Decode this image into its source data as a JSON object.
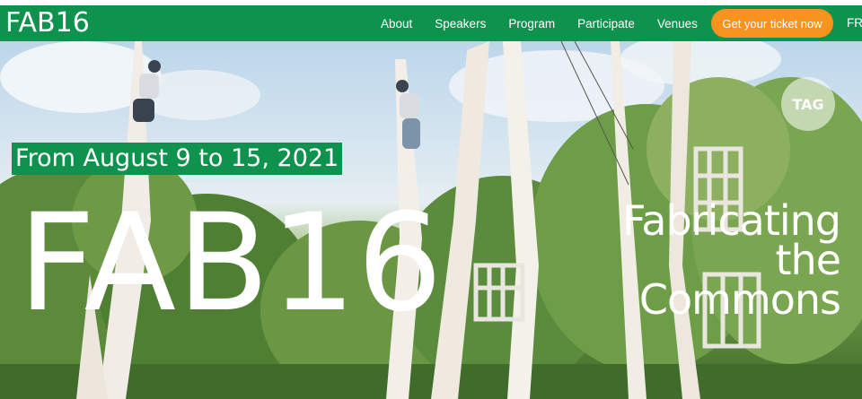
{
  "navbar": {
    "logo": "FAB16",
    "links": [
      "About",
      "Speakers",
      "Program",
      "Participate",
      "Venues"
    ],
    "cta_label": "Get your ticket now",
    "lang_label": "FR"
  },
  "hero": {
    "date_text": "From August 9 to 15, 2021",
    "title": "FAB16",
    "tagline_lines": [
      "Fabricating",
      "the",
      "Commons"
    ],
    "partner_badge_text": "TAG"
  },
  "colors": {
    "brand_green": "#10924f",
    "cta_orange": "#f7931e"
  },
  "icons": [
    "partner-logo-icon"
  ]
}
